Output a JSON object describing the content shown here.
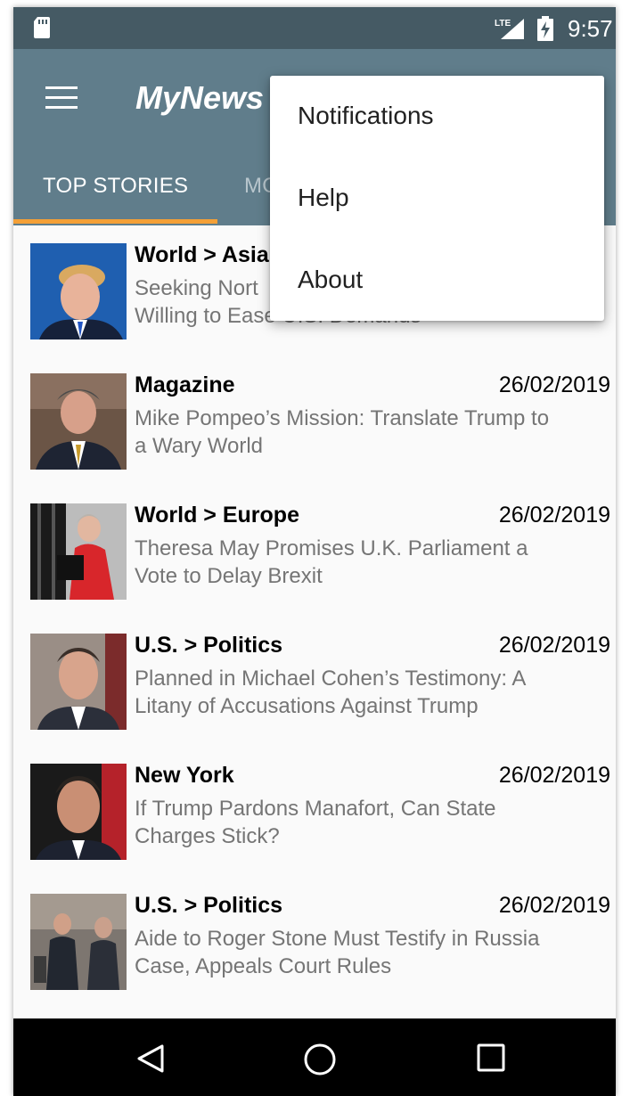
{
  "status_bar": {
    "time": "9:57",
    "network": "LTE"
  },
  "app_bar": {
    "title": "MyNews",
    "menu_icon": "hamburger-menu-icon"
  },
  "tabs": [
    {
      "label": "TOP STORIES",
      "selected": true
    },
    {
      "label": "MO",
      "selected": false
    }
  ],
  "overflow_menu": {
    "items": [
      "Notifications",
      "Help",
      "About"
    ]
  },
  "articles": [
    {
      "section": "World > Asia",
      "date": "",
      "headline_line1": "Seeking Nort",
      "headline_line2": "Willing to Ease U.S. Demands"
    },
    {
      "section": "Magazine",
      "date": "26/02/2019",
      "headline_line1": "Mike Pompeo’s Mission: Translate Trump to",
      "headline_line2": "a Wary World"
    },
    {
      "section": "World > Europe",
      "date": "26/02/2019",
      "headline_line1": "Theresa May Promises U.K. Parliament a",
      "headline_line2": "Vote to Delay Brexit"
    },
    {
      "section": "U.S. > Politics",
      "date": "26/02/2019",
      "headline_line1": "Planned in Michael Cohen’s Testimony: A",
      "headline_line2": "Litany of Accusations Against Trump"
    },
    {
      "section": "New York",
      "date": "26/02/2019",
      "headline_line1": "If Trump Pardons Manafort, Can State",
      "headline_line2": "Charges Stick?"
    },
    {
      "section": "U.S. > Politics",
      "date": "26/02/2019",
      "headline_line1": "Aide to Roger Stone Must Testify in Russia",
      "headline_line2": "Case, Appeals Court Rules"
    }
  ],
  "colors": {
    "status_bar": "#455a64",
    "app_bar": "#607d8b",
    "tab_indicator": "#f4a037",
    "headline_text": "#757575"
  }
}
